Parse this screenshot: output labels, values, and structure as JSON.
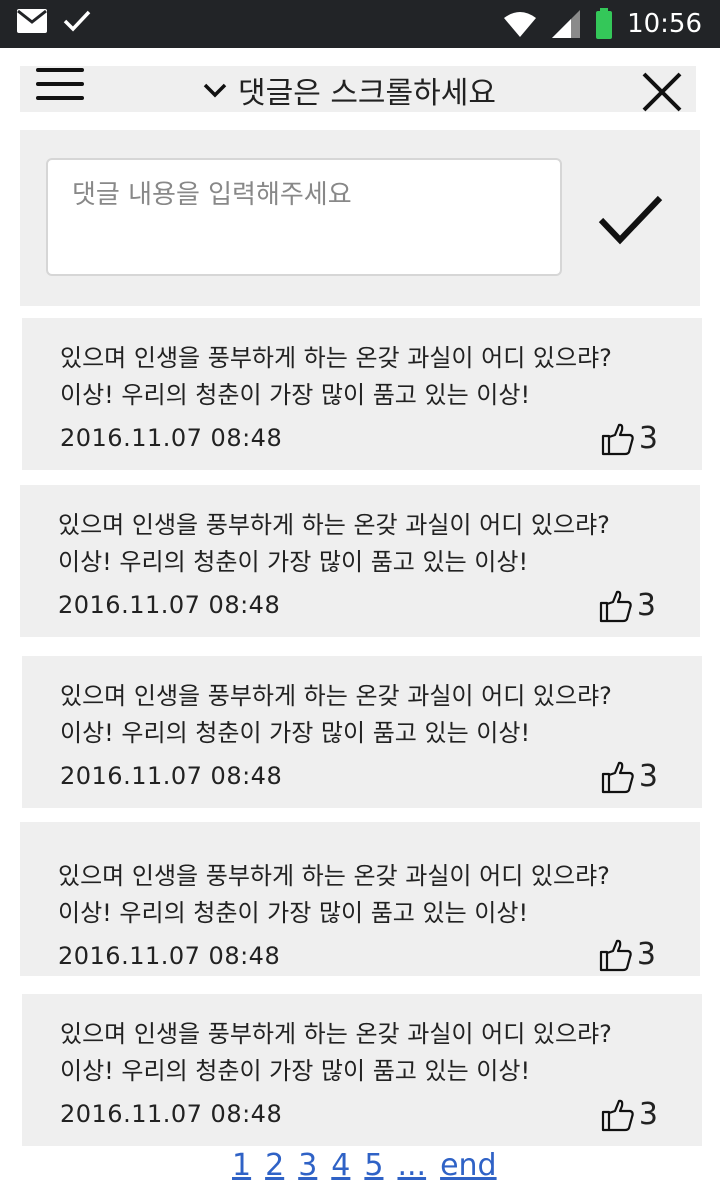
{
  "status_bar": {
    "time": "10:56",
    "icons": [
      "mail-icon",
      "check-icon",
      "wifi-icon",
      "signal-icon",
      "battery-icon"
    ],
    "battery_color": "#34c759"
  },
  "header": {
    "title": "댓글은 스크롤하세요",
    "icons": [
      "menu-icon",
      "chevron-down-icon",
      "close-icon"
    ]
  },
  "composer": {
    "placeholder": "댓글 내용을 입력해주세요",
    "submit_icon": "checkmark-icon"
  },
  "comments": [
    {
      "line1": "있으며 인생을 풍부하게 하는 온갖 과실이 어디 있으랴?",
      "line2": "이상! 우리의 청춘이 가장 많이 품고 있는 이상!",
      "date": "2016.11.07  08:48",
      "likes": "3"
    },
    {
      "line1": "있으며 인생을 풍부하게 하는 온갖 과실이 어디 있으랴?",
      "line2": "이상! 우리의 청춘이 가장 많이 품고 있는 이상!",
      "date": "2016.11.07  08:48",
      "likes": "3"
    },
    {
      "line1": "있으며 인생을 풍부하게 하는 온갖 과실이 어디 있으랴?",
      "line2": "이상! 우리의 청춘이 가장 많이 품고 있는 이상!",
      "date": "2016.11.07  08:48",
      "likes": "3"
    },
    {
      "line1": "있으며 인생을 풍부하게 하는 온갖 과실이 어디 있으랴?",
      "line2": "이상! 우리의 청춘이 가장 많이 품고 있는 이상!",
      "date": "2016.11.07  08:48",
      "likes": "3"
    },
    {
      "line1": "있으며 인생을 풍부하게 하는 온갖 과실이 어디 있으랴?",
      "line2": "이상! 우리의 청춘이 가장 많이 품고 있는 이상!",
      "date": "2016.11.07  08:48",
      "likes": "3"
    }
  ],
  "pagination": {
    "pages": [
      "1",
      "2",
      "3",
      "4",
      "5"
    ],
    "ellipsis": "...",
    "end": "end",
    "link_color": "#2f62c6"
  }
}
